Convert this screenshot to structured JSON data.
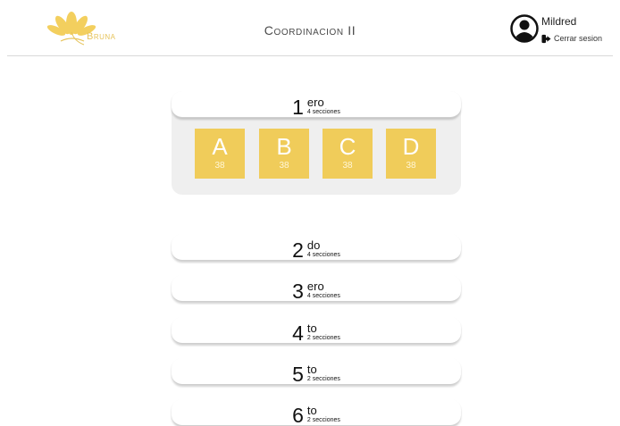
{
  "header": {
    "logo_text": "Bruna",
    "title": "Coordinacion II",
    "user_name": "Mildred",
    "logout_label": "Cerrar sesion"
  },
  "colors": {
    "accent": "#f0cc5a",
    "panel": "#efefef"
  },
  "grades": [
    {
      "number": "1",
      "suffix": "ero",
      "sections_label": "4 secciones",
      "expanded": true,
      "sections": [
        {
          "letter": "A",
          "count": "38"
        },
        {
          "letter": "B",
          "count": "38"
        },
        {
          "letter": "C",
          "count": "38"
        },
        {
          "letter": "D",
          "count": "38"
        }
      ]
    },
    {
      "number": "2",
      "suffix": "do",
      "sections_label": "4 secciones",
      "expanded": false
    },
    {
      "number": "3",
      "suffix": "ero",
      "sections_label": "4 secciones",
      "expanded": false
    },
    {
      "number": "4",
      "suffix": "to",
      "sections_label": "2 secciones",
      "expanded": false
    },
    {
      "number": "5",
      "suffix": "to",
      "sections_label": "2 secciones",
      "expanded": false
    },
    {
      "number": "6",
      "suffix": "to",
      "sections_label": "2 secciones",
      "expanded": false
    }
  ]
}
